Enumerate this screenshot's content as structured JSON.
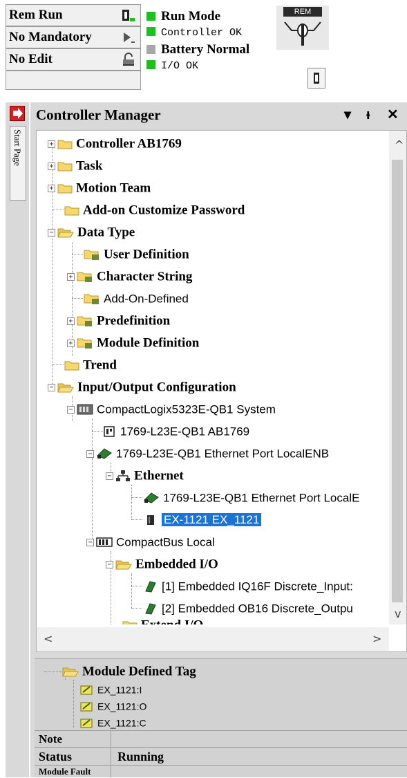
{
  "status": {
    "mode_rows": [
      {
        "label": "Rem Run",
        "icon": "run-mode-icon"
      },
      {
        "label": "No Mandatory",
        "icon": "forces-arrow-icon"
      },
      {
        "label": "No Edit",
        "icon": "edit-lock-icon"
      }
    ],
    "indicators": [
      {
        "label": "Run Mode",
        "color": "#1fbf1f"
      },
      {
        "label": "Controller OK",
        "color": "#1fbf1f"
      },
      {
        "label": "Battery Normal",
        "color": "#a8a8a8"
      },
      {
        "label": "I/O OK",
        "color": "#1fbf1f"
      }
    ],
    "keyswitch_label": "REM"
  },
  "start_page_tab": "Start Page",
  "manager": {
    "title": "Controller Manager",
    "controls": {
      "menu": "▾",
      "pin": "ᵻ",
      "close": "✕"
    }
  },
  "tree": {
    "items": [
      {
        "label": "Controller AB1769",
        "icon": "folder-icon"
      },
      {
        "label": "Task",
        "icon": "folder-icon"
      },
      {
        "label": "Motion Team",
        "icon": "folder-icon"
      },
      {
        "label": "Add-on Customize Password",
        "icon": "folder-icon"
      },
      {
        "label": "Data Type",
        "icon": "folder-open-icon"
      },
      {
        "label": "User Definition",
        "icon": "datatype-folder-icon"
      },
      {
        "label": "Character String",
        "icon": "datatype-folder-icon"
      },
      {
        "label": "Add-On-Defined",
        "icon": "datatype-folder-icon"
      },
      {
        "label": "Predefinition",
        "icon": "datatype-folder-icon"
      },
      {
        "label": "Module Definition",
        "icon": "datatype-folder-icon"
      },
      {
        "label": "Trend",
        "icon": "folder-icon"
      },
      {
        "label": "Input/Output Configuration",
        "icon": "folder-open-icon"
      },
      {
        "label": "CompactLogix5323E-QB1 System",
        "icon": "chassis-icon"
      },
      {
        "label": "1769-L23E-QB1 AB1769",
        "icon": "controller-icon"
      },
      {
        "label": "1769-L23E-QB1 Ethernet Port LocalENB",
        "icon": "ethernet-module-icon"
      },
      {
        "label": "Ethernet",
        "icon": "network-icon"
      },
      {
        "label": "1769-L23E-QB1 Ethernet Port LocalE",
        "icon": "ethernet-module-icon"
      },
      {
        "label": "EX-1121 EX_1121",
        "icon": "device-module-icon"
      },
      {
        "label": "CompactBus Local",
        "icon": "bus-icon"
      },
      {
        "label": "Embedded I/O",
        "icon": "folder-open-icon"
      },
      {
        "label": "[1] Embedded IQ16F Discrete_Input:",
        "icon": "io-module-icon"
      },
      {
        "label": "[2] Embedded OB16 Discrete_Outpu",
        "icon": "io-module-icon"
      },
      {
        "label": "Extend I/O",
        "icon": "folder-icon"
      }
    ],
    "scroll": {
      "up": "^",
      "down": "v",
      "left": "<",
      "right": ">"
    }
  },
  "detail": {
    "header": "Module Defined Tag",
    "tags": [
      "EX_1121:I",
      "EX_1121:O",
      "EX_1121:C"
    ],
    "properties": [
      {
        "key": "Note",
        "value": ""
      },
      {
        "key": "Status",
        "value": "Running"
      },
      {
        "key": "Module Fault",
        "value": ""
      }
    ]
  },
  "colors": {
    "selection": "#1a74d6",
    "folder": "#f5d76e",
    "panel": "#d9d9d9"
  }
}
